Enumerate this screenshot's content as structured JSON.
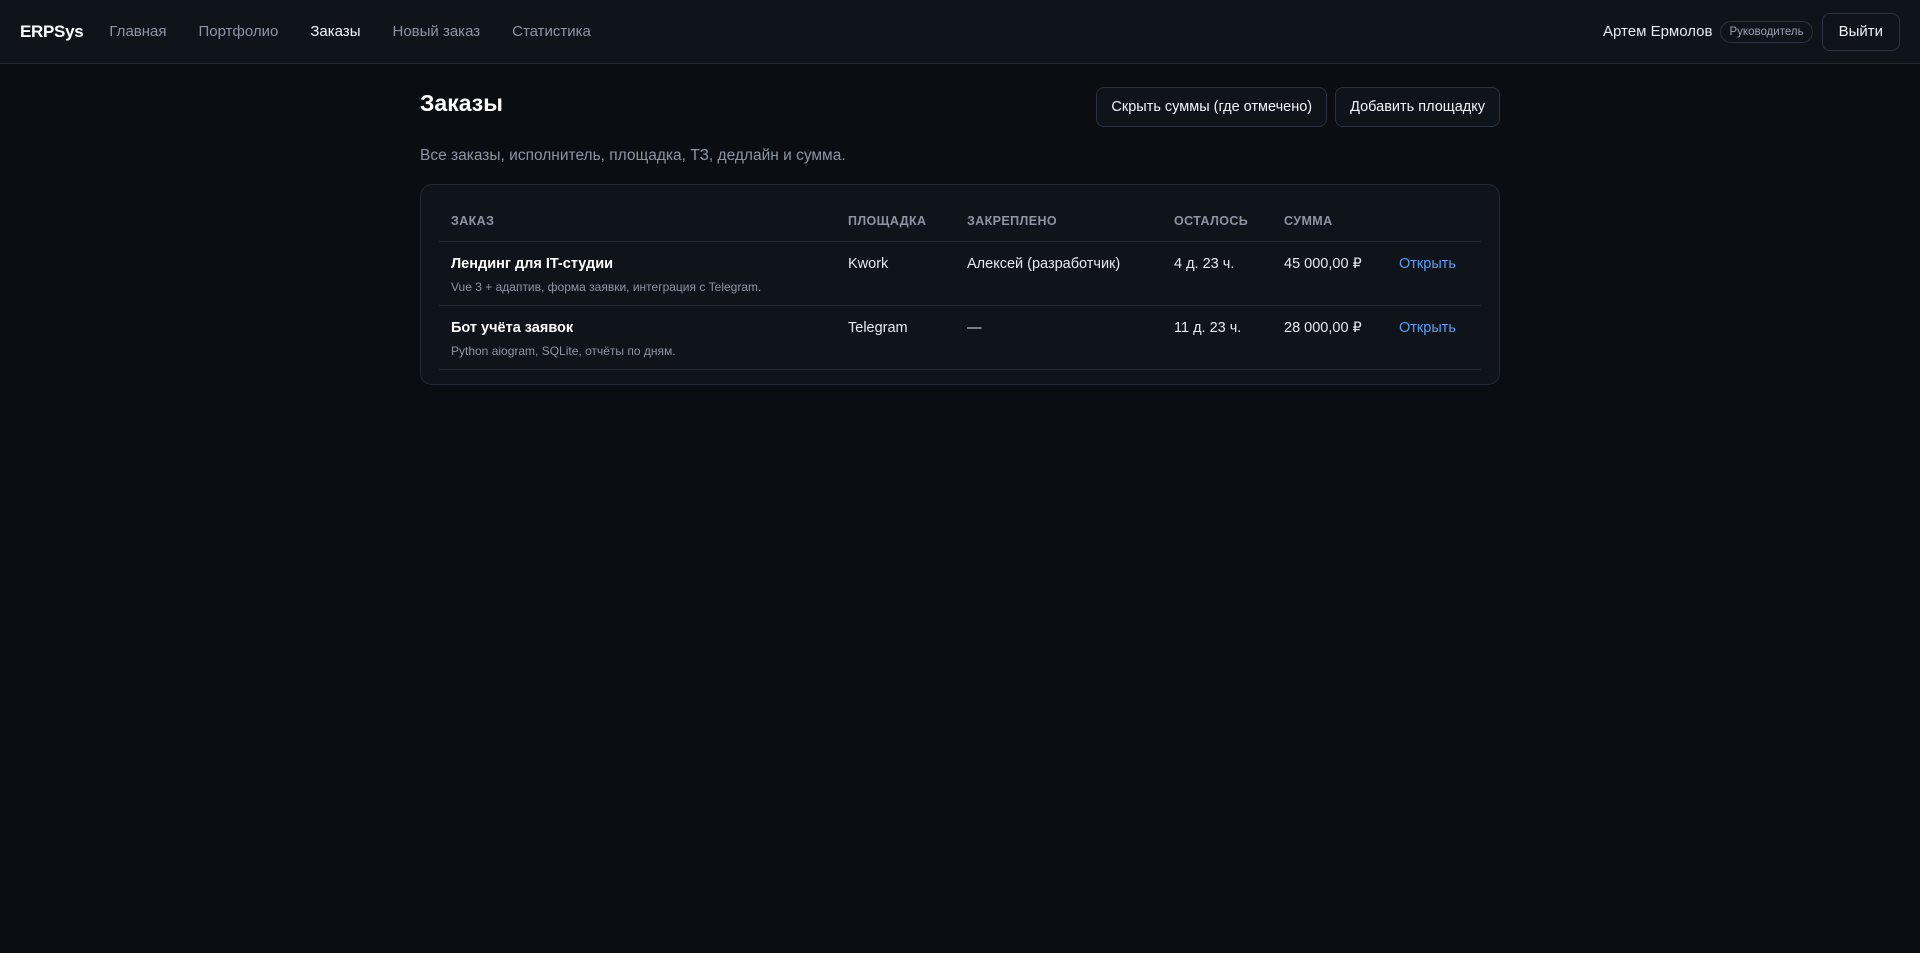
{
  "app": {
    "brand": "ERPSys"
  },
  "nav": {
    "items": [
      {
        "label": "Главная",
        "active": false
      },
      {
        "label": "Портфолио",
        "active": false
      },
      {
        "label": "Заказы",
        "active": true
      },
      {
        "label": "Новый заказ",
        "active": false
      },
      {
        "label": "Статистика",
        "active": false
      }
    ]
  },
  "user": {
    "name": "Артем Ермолов",
    "role": "Руководитель",
    "logout_label": "Выйти"
  },
  "page": {
    "title": "Заказы",
    "subtitle": "Все заказы, исполнитель, площадка, ТЗ, дедлайн и сумма.",
    "actions": {
      "hide_sums_label": "Скрыть суммы (где отмечено)",
      "add_platform_label": "Добавить площадку"
    }
  },
  "table": {
    "headers": {
      "order": "ЗАКАЗ",
      "platform": "ПЛОЩАДКА",
      "assigned": "ЗАКРЕПЛЕНО",
      "remaining": "ОСТАЛОСЬ",
      "sum": "СУММА"
    },
    "rows": [
      {
        "title": "Лендинг для IT-студии",
        "description": "Vue 3 + адаптив, форма заявки, интеграция с Telegram.",
        "platform": "Kwork",
        "assigned": "Алексей (разработчик)",
        "remaining": "4 д. 23 ч.",
        "sum": "45 000,00 ₽",
        "action": "Открыть"
      },
      {
        "title": "Бот учёта заявок",
        "description": "Python aiogram, SQLite, отчёты по дням.",
        "platform": "Telegram",
        "assigned": "—",
        "remaining": "11 д. 23 ч.",
        "sum": "28 000,00 ₽",
        "action": "Открыть"
      }
    ]
  },
  "colors": {
    "background": "#0a0d12",
    "surface": "#0f141b",
    "border": "#222a36",
    "muted_text": "#8b95a5",
    "link": "#5b9cf5"
  }
}
